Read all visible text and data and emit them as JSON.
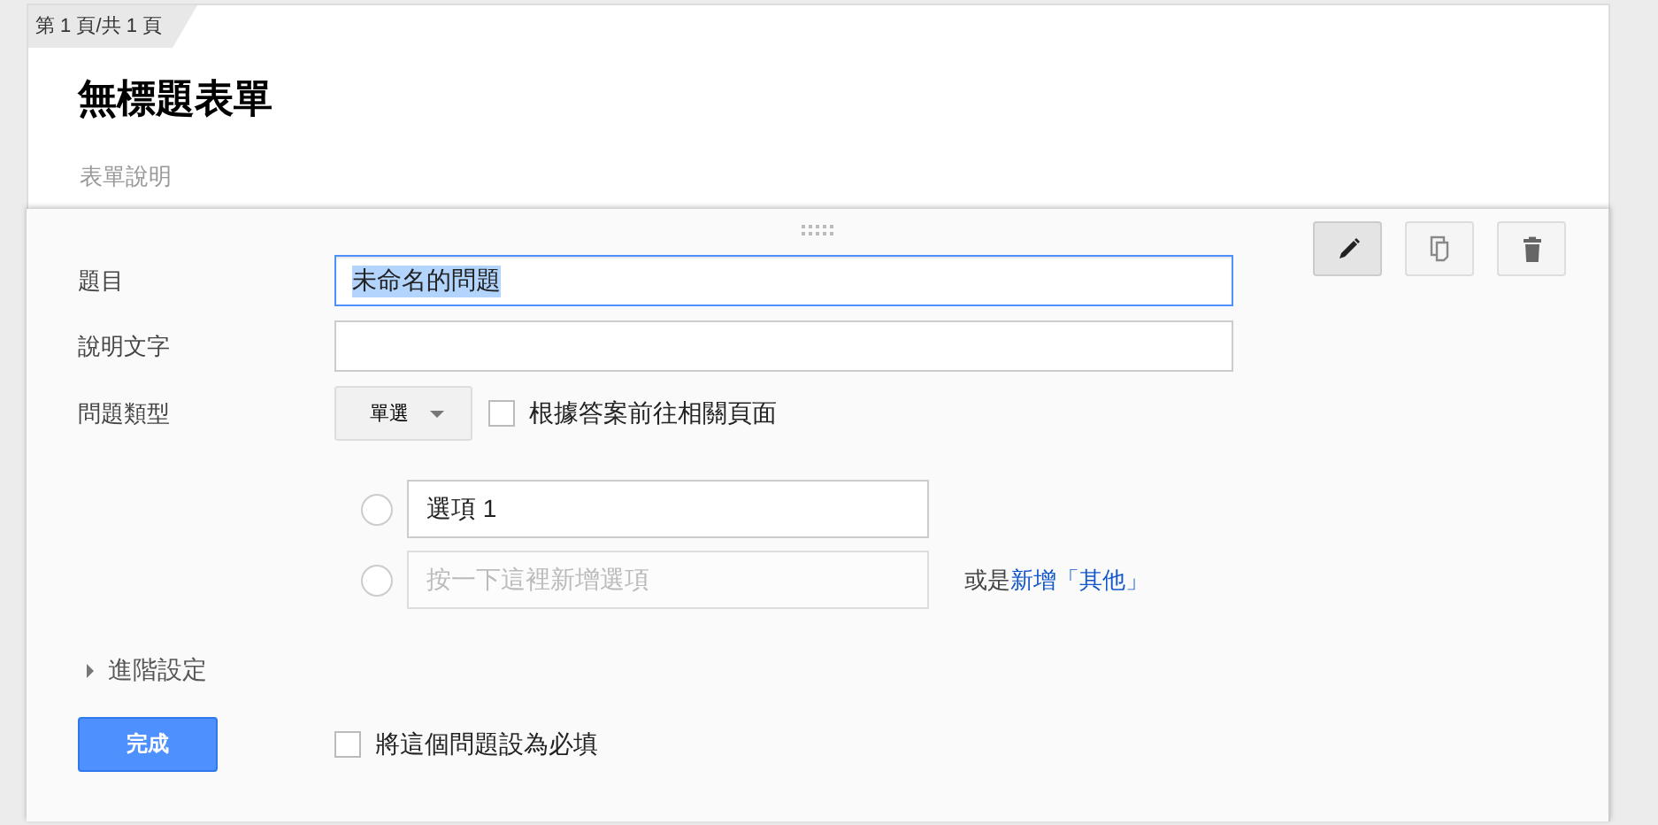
{
  "page_indicator": "第 1 頁/共 1 頁",
  "form": {
    "title": "無標題表單",
    "description": "表單說明"
  },
  "toolbar": [
    {
      "kind": "edit",
      "selected": true
    },
    {
      "kind": "copy",
      "selected": false
    },
    {
      "kind": "delete",
      "selected": false
    }
  ],
  "fields": [
    {
      "label": "題目",
      "value": "未命名的問題",
      "focused": true,
      "text_selected": true
    },
    {
      "label": "說明文字",
      "focused": false
    }
  ],
  "question_type": {
    "label": "問題類型",
    "value": "單選"
  },
  "page_navigation": {
    "label": "根據答案前往相關頁面",
    "checked": false
  },
  "options": [
    {
      "kind": "option",
      "value": "選項 1",
      "selected": false
    },
    {
      "kind": "new",
      "placeholder": "按一下這裡新增選項",
      "selected": false
    }
  ],
  "other": {
    "prefix": "或是",
    "link": "新增「其他」"
  },
  "advanced": {
    "label": "進階設定",
    "expanded": false
  },
  "done_button": "完成",
  "required": {
    "label": "將這個問題設為必填",
    "checked": false
  }
}
